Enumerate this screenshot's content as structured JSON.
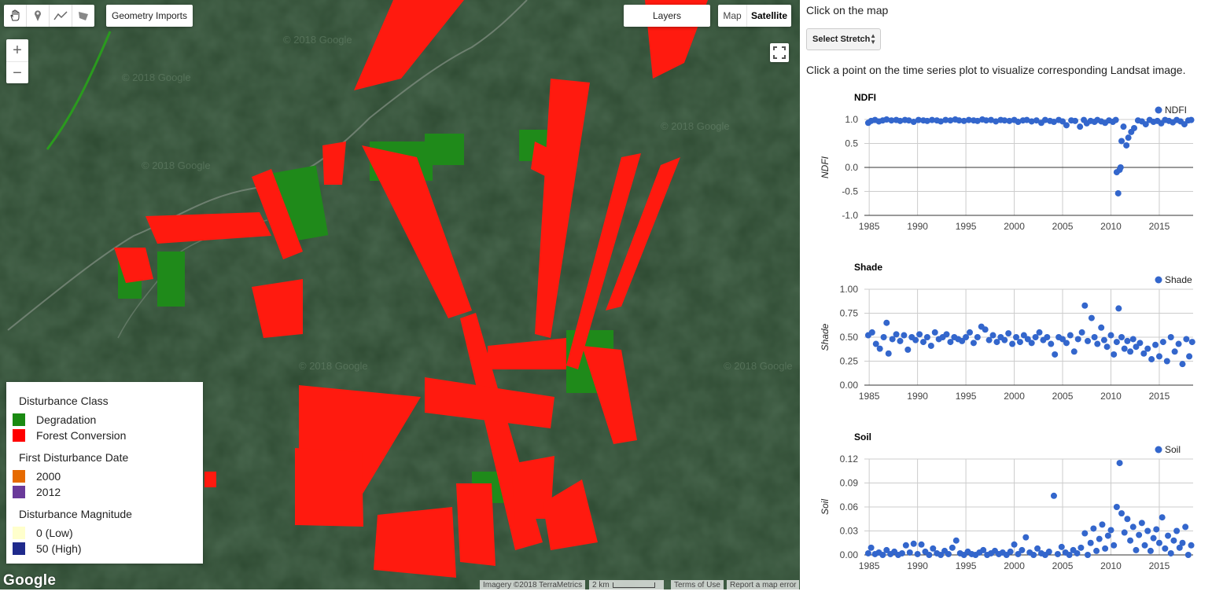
{
  "map": {
    "geometry_imports_label": "Geometry Imports",
    "layers_label": "Layers",
    "maptype": {
      "map_label": "Map",
      "satellite_label": "Satellite",
      "selected": "Satellite"
    },
    "zoom": {
      "in_label": "+",
      "out_label": "−"
    },
    "watermark": "© 2018 Google",
    "google_logo": "Google",
    "attribution": {
      "imagery": "Imagery ©2018 TerraMetrics",
      "scale": "2 km",
      "terms": "Terms of Use",
      "report": "Report a map error"
    },
    "colors": {
      "forest": "#2e4a32",
      "conversion": "#ff1a0f",
      "degradation": "#1f8a1a"
    }
  },
  "draw_tools": [
    "hand-icon",
    "marker-icon",
    "line-icon",
    "polygon-icon"
  ],
  "legend": {
    "class_title": "Disturbance Class",
    "class_items": [
      {
        "label": "Degradation",
        "color": "#1a8a12"
      },
      {
        "label": "Forest Conversion",
        "color": "#ff0000"
      }
    ],
    "date_title": "First Disturbance Date",
    "date_items": [
      {
        "label": "2000",
        "color": "#e66a00"
      },
      {
        "label": "2012",
        "color": "#6a3a9a"
      }
    ],
    "magnitude_title": "Disturbance Magnitude",
    "magnitude_items": [
      {
        "label": "0 (Low)",
        "color": "#ffffcc"
      },
      {
        "label": "50 (High)",
        "color": "#1f2a8c"
      }
    ]
  },
  "panel": {
    "title": "Click on the map",
    "stretch_label": "Select Stretch",
    "instruction": "Click a point on the time series plot to visualize corresponding Landsat image."
  },
  "chart_data": [
    {
      "type": "scatter",
      "title": "NDFI",
      "ylabel": "NDFI",
      "legend": "NDFI",
      "legend_position": "top-right",
      "xlim": [
        1984.5,
        2018.5
      ],
      "ylim": [
        -1.0,
        1.0
      ],
      "x_ticks": [
        "1985",
        "1990",
        "1995",
        "2000",
        "2005",
        "2010",
        "2015"
      ],
      "y_ticks": [
        "1.0",
        "0.5",
        "0.0",
        "-0.5",
        "-1.0"
      ],
      "zero_line": true,
      "grid": true,
      "color": "#3366cc",
      "points": [
        [
          1984.9,
          0.93
        ],
        [
          1985.2,
          0.97
        ],
        [
          1985.6,
          0.99
        ],
        [
          1986.0,
          0.96
        ],
        [
          1986.4,
          0.98
        ],
        [
          1986.8,
          1.0
        ],
        [
          1987.3,
          0.98
        ],
        [
          1987.8,
          0.99
        ],
        [
          1988.2,
          0.97
        ],
        [
          1988.7,
          0.99
        ],
        [
          1989.1,
          0.98
        ],
        [
          1989.6,
          0.95
        ],
        [
          1990.1,
          0.99
        ],
        [
          1990.6,
          0.98
        ],
        [
          1991.0,
          0.97
        ],
        [
          1991.5,
          0.99
        ],
        [
          1992.0,
          0.98
        ],
        [
          1992.4,
          0.96
        ],
        [
          1992.9,
          0.99
        ],
        [
          1993.4,
          0.98
        ],
        [
          1993.9,
          1.0
        ],
        [
          1994.3,
          0.98
        ],
        [
          1994.8,
          0.97
        ],
        [
          1995.3,
          0.99
        ],
        [
          1995.8,
          0.98
        ],
        [
          1996.2,
          0.97
        ],
        [
          1996.7,
          1.0
        ],
        [
          1997.1,
          0.98
        ],
        [
          1997.6,
          0.99
        ],
        [
          1998.1,
          0.96
        ],
        [
          1998.6,
          0.99
        ],
        [
          1999.0,
          0.98
        ],
        [
          1999.5,
          0.97
        ],
        [
          2000.0,
          0.99
        ],
        [
          2000.4,
          0.95
        ],
        [
          2000.9,
          0.98
        ],
        [
          2001.3,
          0.99
        ],
        [
          2001.8,
          0.96
        ],
        [
          2002.3,
          0.98
        ],
        [
          2002.8,
          0.93
        ],
        [
          2003.2,
          0.99
        ],
        [
          2003.7,
          0.97
        ],
        [
          2004.1,
          0.95
        ],
        [
          2004.6,
          0.99
        ],
        [
          2005.0,
          0.96
        ],
        [
          2005.4,
          0.88
        ],
        [
          2005.9,
          0.98
        ],
        [
          2006.3,
          0.97
        ],
        [
          2006.8,
          0.85
        ],
        [
          2007.2,
          0.99
        ],
        [
          2007.5,
          0.92
        ],
        [
          2007.9,
          0.97
        ],
        [
          2008.3,
          0.95
        ],
        [
          2008.6,
          0.99
        ],
        [
          2009.0,
          0.96
        ],
        [
          2009.4,
          0.93
        ],
        [
          2009.8,
          0.98
        ],
        [
          2010.2,
          0.95
        ],
        [
          2010.5,
          0.99
        ],
        [
          2010.6,
          -0.1
        ],
        [
          2010.75,
          -0.54
        ],
        [
          2010.9,
          -0.05
        ],
        [
          2011.0,
          0.0
        ],
        [
          2011.1,
          0.55
        ],
        [
          2011.3,
          0.85
        ],
        [
          2011.6,
          0.46
        ],
        [
          2011.8,
          0.62
        ],
        [
          2012.1,
          0.74
        ],
        [
          2012.4,
          0.82
        ],
        [
          2012.8,
          0.98
        ],
        [
          2013.2,
          0.96
        ],
        [
          2013.6,
          0.9
        ],
        [
          2014.0,
          0.99
        ],
        [
          2014.4,
          0.95
        ],
        [
          2014.8,
          0.97
        ],
        [
          2015.2,
          0.92
        ],
        [
          2015.6,
          0.99
        ],
        [
          2016.0,
          0.97
        ],
        [
          2016.4,
          0.94
        ],
        [
          2016.8,
          0.99
        ],
        [
          2017.2,
          0.96
        ],
        [
          2017.6,
          0.9
        ],
        [
          2018.0,
          0.98
        ],
        [
          2018.3,
          0.99
        ]
      ]
    },
    {
      "type": "scatter",
      "title": "Shade",
      "ylabel": "Shade",
      "legend": "Shade",
      "legend_position": "top-right",
      "xlim": [
        1984.5,
        2018.5
      ],
      "ylim": [
        0.0,
        1.0
      ],
      "x_ticks": [
        "1985",
        "1990",
        "1995",
        "2000",
        "2005",
        "2010",
        "2015"
      ],
      "y_ticks": [
        "1.00",
        "0.75",
        "0.50",
        "0.25",
        "0.00"
      ],
      "zero_line": false,
      "grid": true,
      "color": "#3366cc",
      "points": [
        [
          1984.9,
          0.52
        ],
        [
          1985.3,
          0.55
        ],
        [
          1985.7,
          0.43
        ],
        [
          1986.1,
          0.38
        ],
        [
          1986.5,
          0.5
        ],
        [
          1986.8,
          0.65
        ],
        [
          1987.0,
          0.33
        ],
        [
          1987.4,
          0.48
        ],
        [
          1987.8,
          0.53
        ],
        [
          1988.2,
          0.46
        ],
        [
          1988.6,
          0.52
        ],
        [
          1989.0,
          0.37
        ],
        [
          1989.4,
          0.5
        ],
        [
          1989.8,
          0.47
        ],
        [
          1990.2,
          0.53
        ],
        [
          1990.6,
          0.45
        ],
        [
          1991.0,
          0.5
        ],
        [
          1991.4,
          0.41
        ],
        [
          1991.8,
          0.55
        ],
        [
          1992.2,
          0.48
        ],
        [
          1992.6,
          0.5
        ],
        [
          1993.0,
          0.53
        ],
        [
          1993.4,
          0.45
        ],
        [
          1993.8,
          0.5
        ],
        [
          1994.2,
          0.48
        ],
        [
          1994.6,
          0.46
        ],
        [
          1995.0,
          0.5
        ],
        [
          1995.4,
          0.55
        ],
        [
          1995.8,
          0.44
        ],
        [
          1996.2,
          0.5
        ],
        [
          1996.6,
          0.61
        ],
        [
          1997.0,
          0.58
        ],
        [
          1997.4,
          0.47
        ],
        [
          1997.8,
          0.52
        ],
        [
          1998.2,
          0.45
        ],
        [
          1998.6,
          0.5
        ],
        [
          1999.0,
          0.47
        ],
        [
          1999.4,
          0.54
        ],
        [
          1999.8,
          0.43
        ],
        [
          2000.2,
          0.5
        ],
        [
          2000.6,
          0.45
        ],
        [
          2001.0,
          0.52
        ],
        [
          2001.4,
          0.48
        ],
        [
          2001.8,
          0.44
        ],
        [
          2002.2,
          0.5
        ],
        [
          2002.6,
          0.55
        ],
        [
          2003.0,
          0.47
        ],
        [
          2003.4,
          0.5
        ],
        [
          2003.8,
          0.43
        ],
        [
          2004.2,
          0.32
        ],
        [
          2004.6,
          0.5
        ],
        [
          2005.0,
          0.48
        ],
        [
          2005.4,
          0.44
        ],
        [
          2005.8,
          0.52
        ],
        [
          2006.2,
          0.35
        ],
        [
          2006.6,
          0.48
        ],
        [
          2007.0,
          0.55
        ],
        [
          2007.3,
          0.83
        ],
        [
          2007.6,
          0.46
        ],
        [
          2008.0,
          0.7
        ],
        [
          2008.3,
          0.5
        ],
        [
          2008.6,
          0.43
        ],
        [
          2009.0,
          0.6
        ],
        [
          2009.3,
          0.47
        ],
        [
          2009.6,
          0.4
        ],
        [
          2010.0,
          0.52
        ],
        [
          2010.3,
          0.32
        ],
        [
          2010.6,
          0.45
        ],
        [
          2010.8,
          0.8
        ],
        [
          2011.1,
          0.5
        ],
        [
          2011.4,
          0.38
        ],
        [
          2011.7,
          0.46
        ],
        [
          2012.0,
          0.35
        ],
        [
          2012.3,
          0.48
        ],
        [
          2012.6,
          0.4
        ],
        [
          2013.0,
          0.44
        ],
        [
          2013.4,
          0.33
        ],
        [
          2013.8,
          0.38
        ],
        [
          2014.2,
          0.27
        ],
        [
          2014.6,
          0.42
        ],
        [
          2015.0,
          0.3
        ],
        [
          2015.4,
          0.45
        ],
        [
          2015.8,
          0.25
        ],
        [
          2016.2,
          0.5
        ],
        [
          2016.6,
          0.35
        ],
        [
          2017.0,
          0.43
        ],
        [
          2017.4,
          0.22
        ],
        [
          2017.8,
          0.48
        ],
        [
          2018.1,
          0.3
        ],
        [
          2018.4,
          0.45
        ]
      ]
    },
    {
      "type": "scatter",
      "title": "Soil",
      "ylabel": "Soil",
      "legend": "Soil",
      "legend_position": "top-right",
      "xlim": [
        1984.5,
        2018.5
      ],
      "ylim": [
        0.0,
        0.12
      ],
      "x_ticks": [
        "1985",
        "1990",
        "1995",
        "2000",
        "2005",
        "2010",
        "2015"
      ],
      "y_ticks": [
        "0.12",
        "0.09",
        "0.06",
        "0.03",
        "0.00"
      ],
      "zero_line": false,
      "grid": true,
      "color": "#3366cc",
      "points": [
        [
          1984.9,
          0.002
        ],
        [
          1985.2,
          0.009
        ],
        [
          1985.6,
          0.001
        ],
        [
          1986.0,
          0.003
        ],
        [
          1986.4,
          0.0
        ],
        [
          1986.8,
          0.006
        ],
        [
          1987.2,
          0.001
        ],
        [
          1987.6,
          0.004
        ],
        [
          1988.0,
          0.0
        ],
        [
          1988.4,
          0.002
        ],
        [
          1988.8,
          0.012
        ],
        [
          1989.2,
          0.003
        ],
        [
          1989.6,
          0.014
        ],
        [
          1990.0,
          0.001
        ],
        [
          1990.4,
          0.013
        ],
        [
          1990.8,
          0.004
        ],
        [
          1991.2,
          0.0
        ],
        [
          1991.6,
          0.008
        ],
        [
          1992.0,
          0.002
        ],
        [
          1992.4,
          0.0
        ],
        [
          1992.8,
          0.005
        ],
        [
          1993.2,
          0.001
        ],
        [
          1993.6,
          0.009
        ],
        [
          1994.0,
          0.018
        ],
        [
          1994.4,
          0.002
        ],
        [
          1994.8,
          0.0
        ],
        [
          1995.2,
          0.004
        ],
        [
          1995.6,
          0.001
        ],
        [
          1996.0,
          0.0
        ],
        [
          1996.4,
          0.003
        ],
        [
          1996.8,
          0.006
        ],
        [
          1997.2,
          0.0
        ],
        [
          1997.6,
          0.002
        ],
        [
          1998.0,
          0.005
        ],
        [
          1998.4,
          0.001
        ],
        [
          1998.8,
          0.003
        ],
        [
          1999.2,
          0.0
        ],
        [
          1999.6,
          0.004
        ],
        [
          2000.0,
          0.013
        ],
        [
          2000.4,
          0.001
        ],
        [
          2000.8,
          0.006
        ],
        [
          2001.2,
          0.022
        ],
        [
          2001.6,
          0.003
        ],
        [
          2002.0,
          0.0
        ],
        [
          2002.4,
          0.008
        ],
        [
          2002.8,
          0.002
        ],
        [
          2003.2,
          0.0
        ],
        [
          2003.6,
          0.004
        ],
        [
          2004.1,
          0.074
        ],
        [
          2004.5,
          0.001
        ],
        [
          2004.9,
          0.01
        ],
        [
          2005.3,
          0.003
        ],
        [
          2005.7,
          0.0
        ],
        [
          2006.1,
          0.006
        ],
        [
          2006.5,
          0.002
        ],
        [
          2006.9,
          0.009
        ],
        [
          2007.3,
          0.027
        ],
        [
          2007.6,
          0.0
        ],
        [
          2007.9,
          0.015
        ],
        [
          2008.2,
          0.033
        ],
        [
          2008.5,
          0.005
        ],
        [
          2008.8,
          0.02
        ],
        [
          2009.1,
          0.038
        ],
        [
          2009.4,
          0.008
        ],
        [
          2009.7,
          0.024
        ],
        [
          2010.0,
          0.031
        ],
        [
          2010.3,
          0.012
        ],
        [
          2010.6,
          0.06
        ],
        [
          2010.9,
          0.115
        ],
        [
          2011.1,
          0.052
        ],
        [
          2011.4,
          0.028
        ],
        [
          2011.7,
          0.045
        ],
        [
          2012.0,
          0.018
        ],
        [
          2012.3,
          0.035
        ],
        [
          2012.6,
          0.006
        ],
        [
          2012.9,
          0.025
        ],
        [
          2013.2,
          0.04
        ],
        [
          2013.5,
          0.012
        ],
        [
          2013.8,
          0.03
        ],
        [
          2014.1,
          0.005
        ],
        [
          2014.4,
          0.021
        ],
        [
          2014.7,
          0.032
        ],
        [
          2015.0,
          0.015
        ],
        [
          2015.3,
          0.047
        ],
        [
          2015.6,
          0.008
        ],
        [
          2015.9,
          0.024
        ],
        [
          2016.2,
          0.002
        ],
        [
          2016.5,
          0.018
        ],
        [
          2016.8,
          0.03
        ],
        [
          2017.1,
          0.009
        ],
        [
          2017.4,
          0.015
        ],
        [
          2017.7,
          0.035
        ],
        [
          2018.0,
          0.0
        ],
        [
          2018.3,
          0.012
        ]
      ]
    }
  ]
}
